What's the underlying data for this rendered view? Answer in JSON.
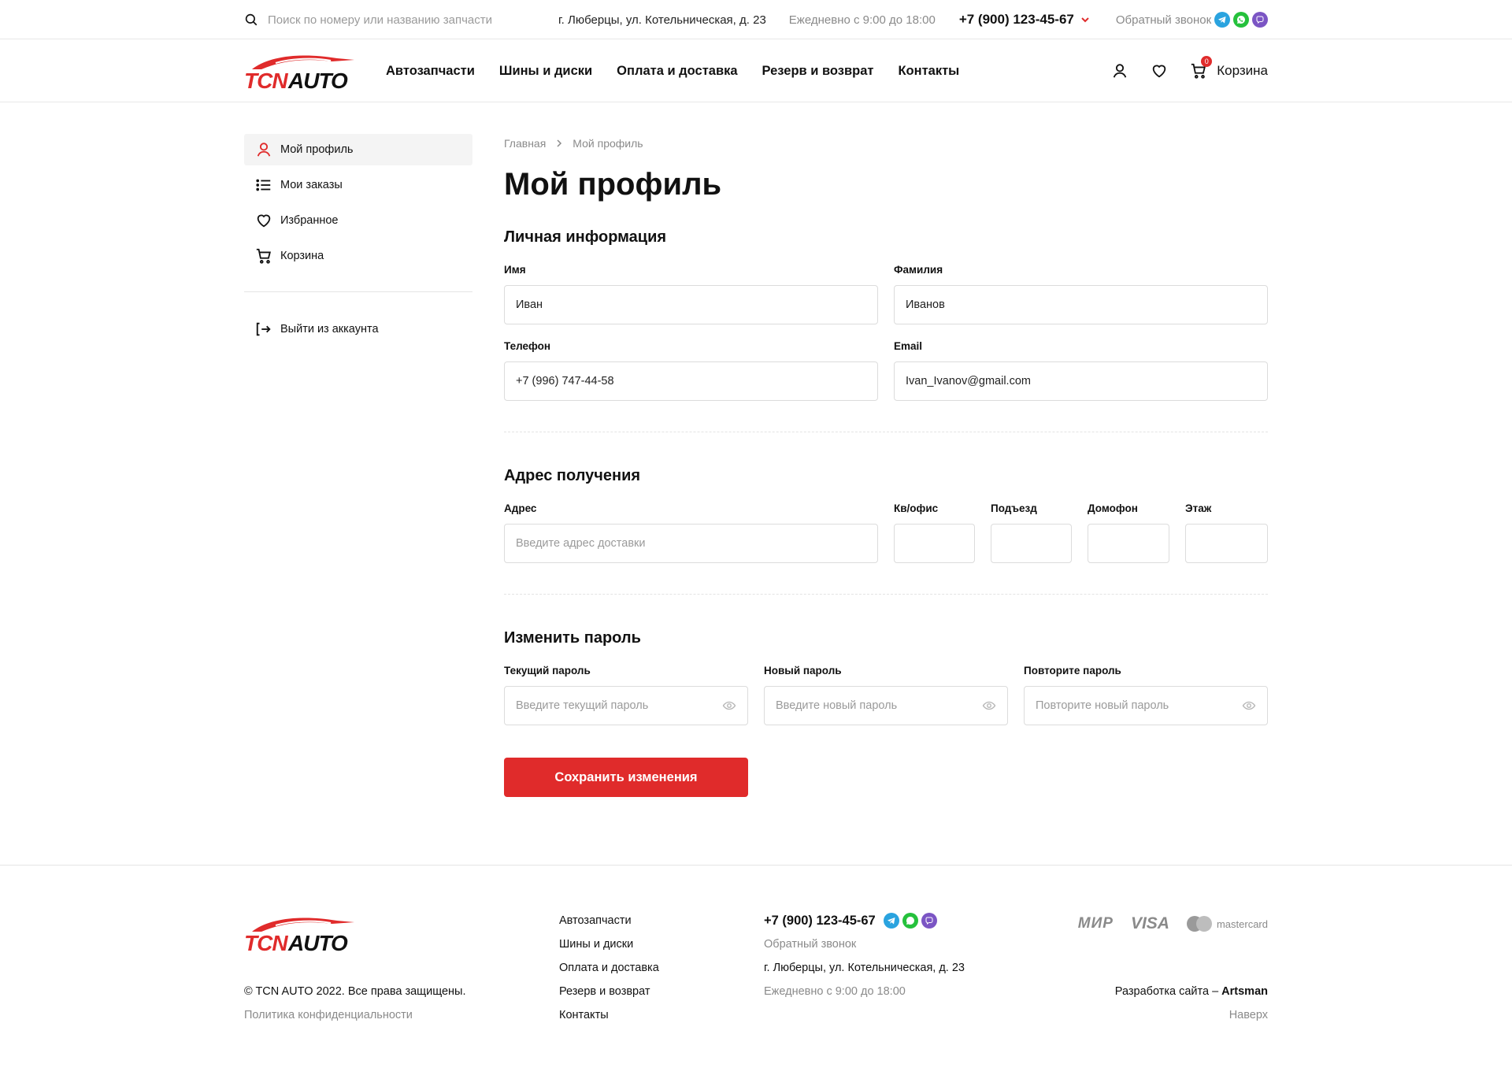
{
  "topbar": {
    "search_placeholder": "Поиск по номеру или названию запчасти",
    "address": "г. Люберцы, ул. Котельническая, д. 23",
    "hours": "Ежедневно с 9:00 до 18:00",
    "phone": "+7 (900) 123-45-67",
    "callback": "Обратный звонок",
    "messengers": [
      "telegram-icon",
      "whatsapp-icon",
      "viber-icon"
    ]
  },
  "header": {
    "logo_text_left": "TCN",
    "logo_text_right": "AUTO",
    "nav": [
      "Автозапчасти",
      "Шины и диски",
      "Оплата и доставка",
      "Резерв и возврат",
      "Контакты"
    ],
    "cart_label": "Корзина",
    "cart_count": "0"
  },
  "sidebar": {
    "items": [
      {
        "label": "Мой профиль",
        "icon": "user-icon",
        "active": true
      },
      {
        "label": "Мои заказы",
        "icon": "list-icon",
        "active": false
      },
      {
        "label": "Избранное",
        "icon": "heart-icon",
        "active": false
      },
      {
        "label": "Корзина",
        "icon": "cart-icon",
        "active": false
      }
    ],
    "logout": "Выйти из аккаунта"
  },
  "breadcrumbs": [
    "Главная",
    "Мой профиль"
  ],
  "page_title": "Мой профиль",
  "personal": {
    "title": "Личная информация",
    "first_name_label": "Имя",
    "first_name_value": "Иван",
    "last_name_label": "Фамилия",
    "last_name_value": "Иванов",
    "phone_label": "Телефон",
    "phone_value": "+7 (996) 747-44-58",
    "email_label": "Email",
    "email_value": "Ivan_Ivanov@gmail.com"
  },
  "address": {
    "title": "Адрес получения",
    "address_label": "Адрес",
    "address_placeholder": "Введите адрес доставки",
    "apt_label": "Кв/офис",
    "entrance_label": "Подъезд",
    "intercom_label": "Домофон",
    "floor_label": "Этаж"
  },
  "password": {
    "title": "Изменить пароль",
    "current_label": "Текущий пароль",
    "current_placeholder": "Введите текущий пароль",
    "new_label": "Новый пароль",
    "new_placeholder": "Введите новый пароль",
    "repeat_label": "Повторите пароль",
    "repeat_placeholder": "Повторите новый пароль"
  },
  "save_button": "Сохранить изменения",
  "footer": {
    "copyright": "© TCN AUTO 2022. Все права защищены.",
    "policy": "Политика конфиденциальности",
    "nav": [
      "Автозапчасти",
      "Шины и диски",
      "Оплата и доставка",
      "Резерв и возврат",
      "Контакты"
    ],
    "phone": "+7 (900) 123-45-67",
    "callback": "Обратный звонок",
    "address": "г. Люберцы, ул. Котельническая, д. 23",
    "hours": "Ежедневно с 9:00 до 18:00",
    "payments": {
      "mir": "МИР",
      "visa": "VISA",
      "mastercard": "mastercard"
    },
    "dev_prefix": "Разработка сайта – ",
    "dev_name": "Artsman",
    "to_top": "Наверх"
  },
  "colors": {
    "accent": "#e02b2b",
    "muted": "#8a8a8a",
    "border": "#dcdcdc"
  }
}
